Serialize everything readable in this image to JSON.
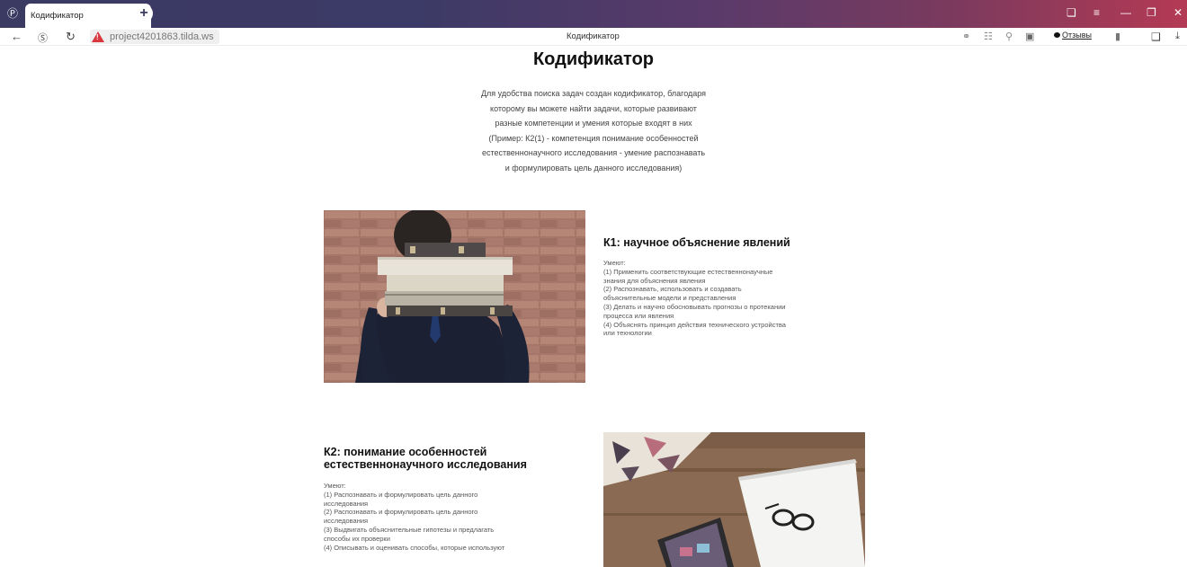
{
  "browser": {
    "tab_title": "Кодификатор",
    "tab_close": "×",
    "new_tab": "+",
    "url": "project4201863.tilda.ws",
    "page_title": "Кодификатор",
    "reviews_label": "Отзывы",
    "icons": [
      "browser-logo-icon",
      "back-icon",
      "yandex-icon",
      "reload-icon",
      "warning-icon",
      "headphones-icon",
      "reader-icon",
      "search-icon",
      "extension-icon",
      "bookmark-icon",
      "share-icon",
      "download-icon",
      "minimize-icon",
      "maximize-icon",
      "close-icon",
      "menu-icon",
      "collections-icon"
    ]
  },
  "page": {
    "title": "Кодификатор",
    "intro_lines": [
      "Для удобства поиска задач создан кодификатор, благодаря",
      "которому вы можете найти задачи, которые развивают",
      "разные компетенции и умения которые входят в них",
      "(Пример: К2(1) - компетенция понимание особенностей",
      "естественнонаучного исследования - умение распознавать",
      "и формулировать цель данного исследования)"
    ]
  },
  "cards": [
    {
      "title": "К1: научное объяснение явлений",
      "lines": [
        "Умеют:",
        "(1) Применить соответствующие естественнонаучные",
        "знания для объяснения явления",
        "(2) Распознавать, использовать и создавать",
        "объяснительные модели и представления",
        "(3) Делать и научно обосновывать прогнозы о протекании",
        "процесса или явления",
        "(4) Объяснять принцип действия технического устройства",
        "или технологии"
      ]
    },
    {
      "title_lines": [
        "К2: понимание особенностей",
        "естественнонаучного исследования"
      ],
      "lines": [
        "Умеют:",
        "(1) Распознавать и формулировать цель данного",
        "исследования",
        "(2) Распознавать и формулировать цель данного",
        "исследования",
        "(3) Выдвигать объяснительные гипотезы и предлагать",
        "способы их проверки",
        "(4) Описывать и оценивать способы, которые используют"
      ]
    }
  ]
}
